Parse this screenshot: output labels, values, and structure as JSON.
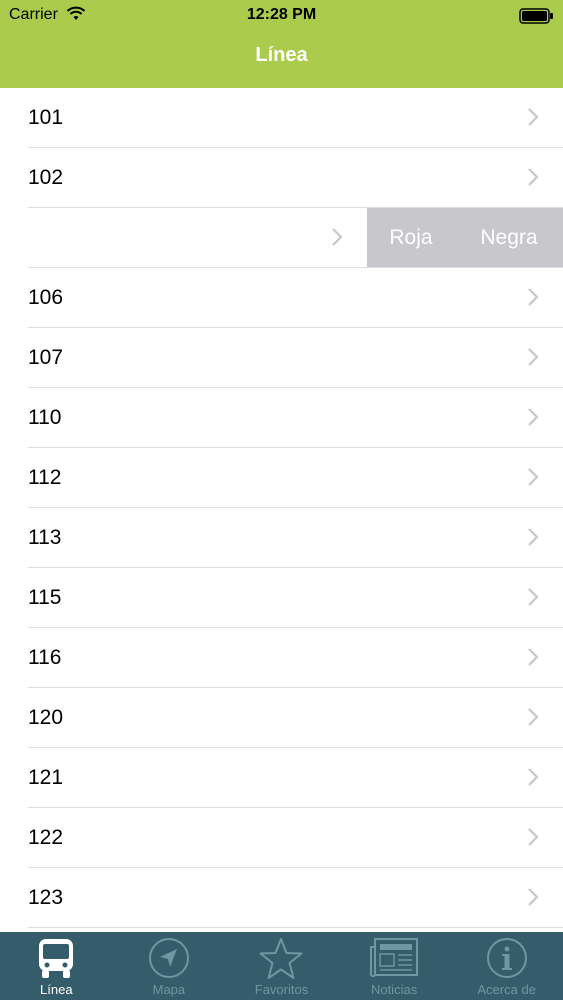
{
  "status_bar": {
    "carrier": "Carrier",
    "time": "12:28 PM"
  },
  "nav": {
    "title": "Línea"
  },
  "lines": [
    "101",
    "102",
    "",
    "106",
    "107",
    "110",
    "112",
    "113",
    "115",
    "116",
    "120",
    "121",
    "122",
    "123"
  ],
  "swipe_actions": {
    "row_index": 2,
    "labels": [
      "Roja",
      "Negra"
    ]
  },
  "tabs": [
    {
      "label": "Línea",
      "icon": "bus-icon",
      "active": true
    },
    {
      "label": "Mapa",
      "icon": "compass-icon",
      "active": false
    },
    {
      "label": "Favoritos",
      "icon": "star-icon",
      "active": false
    },
    {
      "label": "Noticias",
      "icon": "newspaper-icon",
      "active": false
    },
    {
      "label": "Acerca de",
      "icon": "info-icon",
      "active": false
    }
  ],
  "colors": {
    "header": "#aacb4b",
    "tab_bar": "#345c6a",
    "tab_inactive": "#6f97a2",
    "swipe_action_bg": "#c7c7cc"
  }
}
